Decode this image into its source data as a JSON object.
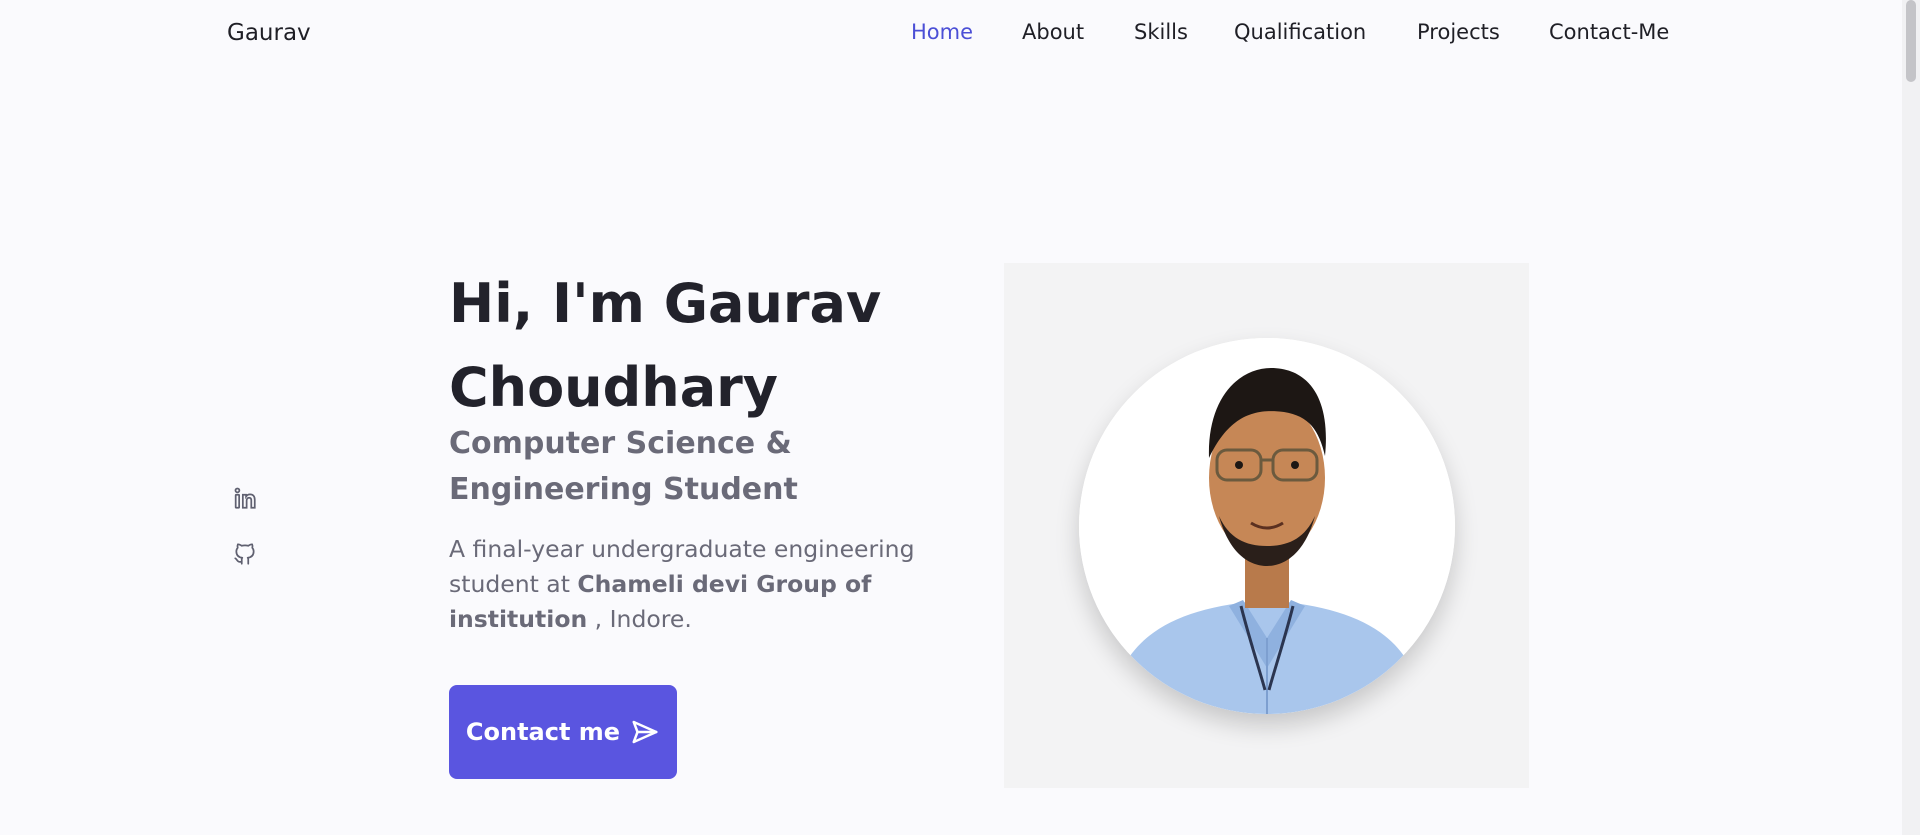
{
  "header": {
    "logo": "Gaurav",
    "nav": [
      {
        "label": "Home",
        "active": true
      },
      {
        "label": "About",
        "active": false
      },
      {
        "label": "Skills",
        "active": false
      },
      {
        "label": "Qualification",
        "active": false
      },
      {
        "label": "Projects",
        "active": false
      },
      {
        "label": "Contact-Me",
        "active": false
      }
    ]
  },
  "social": [
    {
      "icon": "linkedin-icon"
    },
    {
      "icon": "github-icon"
    }
  ],
  "hero": {
    "title": "Hi, I'm Gaurav Choudhary",
    "subtitle": "Computer Science & Engineering Student",
    "desc_prefix": "A final-year undergraduate engineering student at ",
    "desc_bold": "Chameli devi Group of institution",
    "desc_suffix": " , Indore.",
    "button_label": "Contact me",
    "button_icon": "send-icon"
  },
  "profile_photo": {
    "icon": "profile-photo"
  },
  "colors": {
    "accent": "#5a55e0",
    "nav_active": "#4b4fd6",
    "text": "#22222b",
    "muted": "#6a6a78",
    "background": "#fafafd"
  }
}
